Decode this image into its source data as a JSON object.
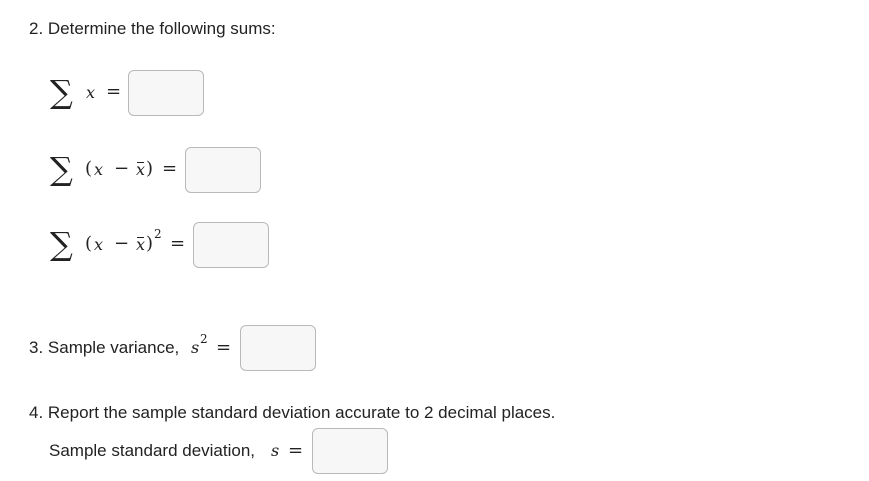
{
  "q2": {
    "heading": "2. Determine the following sums:",
    "sum1": {
      "sigma": "∑",
      "var": "x",
      "eq": "=",
      "value": ""
    },
    "sum2": {
      "sigma": "∑",
      "lparen": "(",
      "var": "x",
      "minus": "−",
      "mean": "x",
      "rparen": ")",
      "eq": "=",
      "value": ""
    },
    "sum3": {
      "sigma": "∑",
      "lparen": "(",
      "var": "x",
      "minus": "−",
      "mean": "x",
      "rparen": ")",
      "exp": "2",
      "eq": "=",
      "value": ""
    }
  },
  "q3": {
    "label": "3. Sample variance,",
    "var": "s",
    "exp": "2",
    "eq": "=",
    "value": ""
  },
  "q4": {
    "prompt": "4. Report the sample standard deviation accurate to 2 decimal places.",
    "label": "Sample standard deviation,",
    "var": "s",
    "eq": "=",
    "value": ""
  }
}
